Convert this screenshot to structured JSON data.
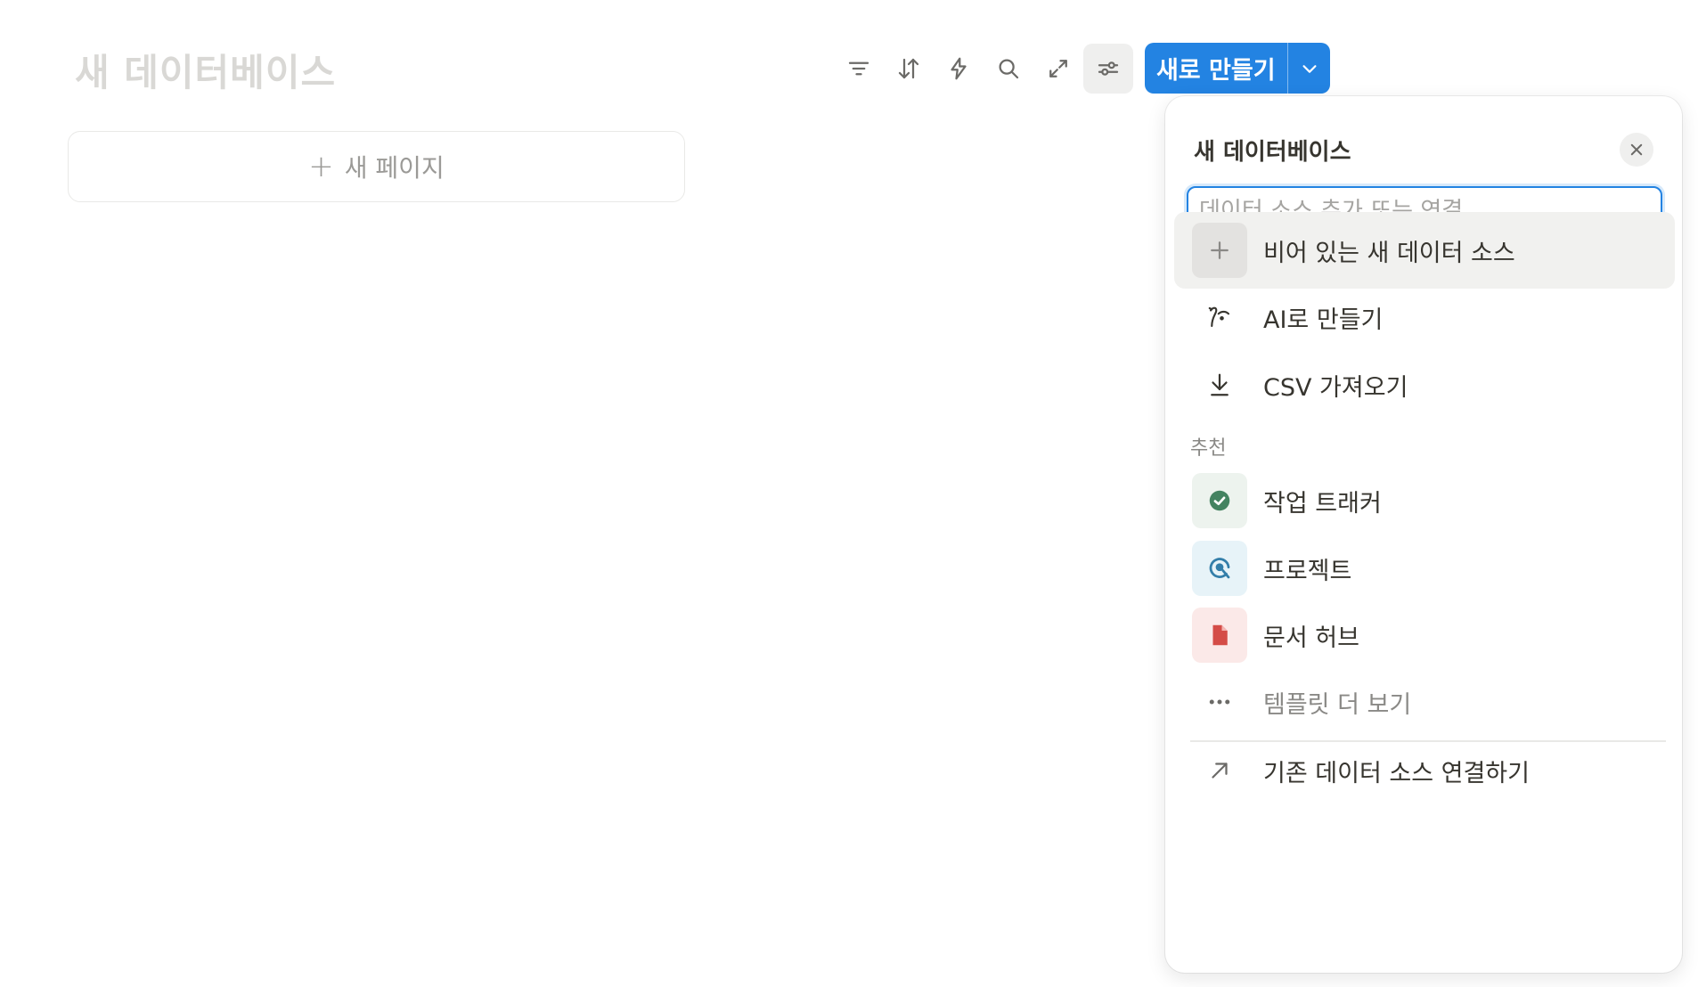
{
  "page": {
    "title": "새 데이터베이스",
    "new_page_label": "새 페이지"
  },
  "toolbar": {
    "icons": [
      "filter-icon",
      "sort-icon",
      "lightning-icon",
      "search-icon",
      "expand-icon",
      "settings-sliders-icon"
    ],
    "new_button_label": "새로 만들기"
  },
  "panel": {
    "title": "새 데이터베이스",
    "search_placeholder": "데이터 소스 추가 또는 연결...",
    "search_value": "",
    "items": [
      {
        "label": "비어 있는 새 데이터 소스",
        "icon": "plus-icon"
      },
      {
        "label": "AI로 만들기",
        "icon": "ai-sparkle-icon"
      },
      {
        "label": "CSV 가져오기",
        "icon": "download-icon"
      }
    ],
    "section_label": "추천",
    "recommended": [
      {
        "label": "작업 트래커",
        "icon": "check-circle-icon",
        "color": "#448361",
        "bg": "#edf3ee"
      },
      {
        "label": "프로젝트",
        "icon": "target-icon",
        "color": "#337ea9",
        "bg": "#e7f3f8"
      },
      {
        "label": "문서 허브",
        "icon": "document-icon",
        "color": "#d44c47",
        "bg": "#fbe9e8"
      }
    ],
    "more_templates_label": "템플릿 더 보기",
    "connect_label": "기존 데이터 소스 연결하기"
  },
  "colors": {
    "accent": "#2383e2"
  }
}
